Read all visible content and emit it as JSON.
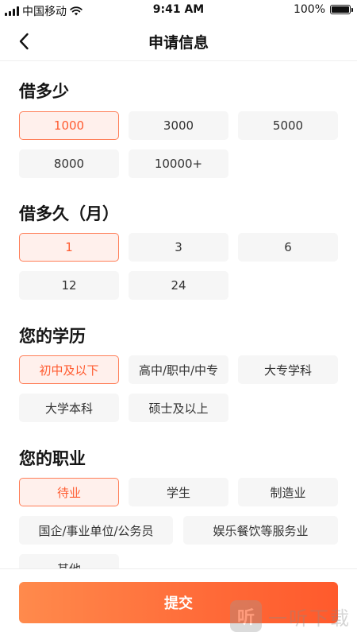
{
  "status_bar": {
    "carrier": "中国移动",
    "time": "9:41 AM",
    "battery_text": "100%",
    "battery_level": 1.0
  },
  "nav": {
    "title": "申请信息",
    "back_icon": "chevron-left-icon"
  },
  "sections": {
    "amount": {
      "title": "借多少",
      "options": [
        "1000",
        "3000",
        "5000",
        "8000",
        "10000+"
      ],
      "selected": "1000"
    },
    "term": {
      "title": "借多久（月）",
      "options": [
        "1",
        "3",
        "6",
        "12",
        "24"
      ],
      "selected": "1"
    },
    "education": {
      "title": "您的学历",
      "options": [
        "初中及以下",
        "高中/职中/中专",
        "大专学科",
        "大学本科",
        "硕士及以上"
      ],
      "selected": "初中及以下"
    },
    "occupation": {
      "title": "您的职业",
      "options": [
        "待业",
        "学生",
        "制造业",
        "国企/事业单位/公务员",
        "娱乐餐饮等服务业",
        "其他"
      ],
      "selected": "待业"
    }
  },
  "submit_label": "提交",
  "watermark": {
    "logo_text": "听",
    "text": "一听下载"
  },
  "colors": {
    "accent": "#ff5b30",
    "selected_bg": "#fff0ec",
    "selected_border": "#ff7e58",
    "option_bg": "#f6f6f6",
    "button_gradient_start": "#ff8a4c",
    "button_gradient_end": "#ff5a2c"
  }
}
